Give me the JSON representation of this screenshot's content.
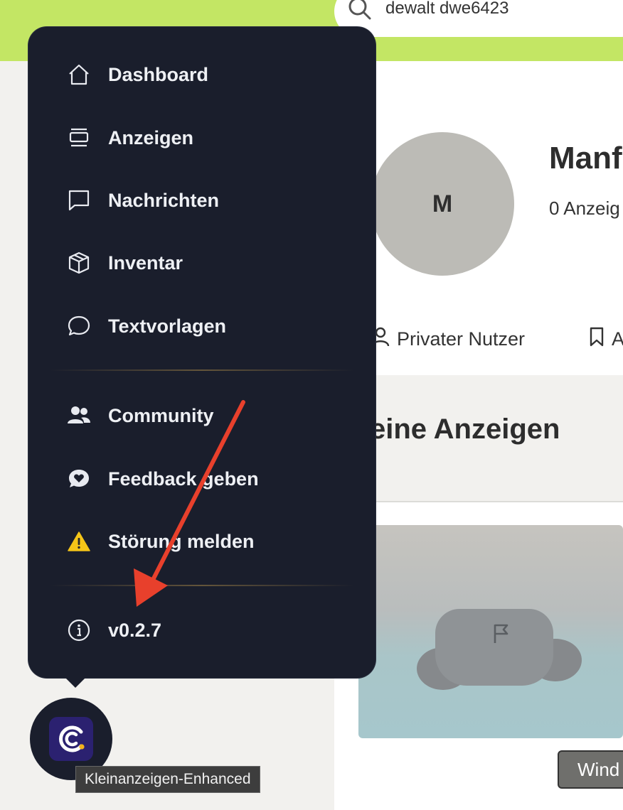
{
  "search": {
    "query": "dewalt dwe6423"
  },
  "profile": {
    "avatar_initial": "M",
    "name": "Manf",
    "listing_count": "0 Anzeig",
    "user_type": "Privater Nutzer",
    "bookmark_label": "A"
  },
  "section": {
    "title": "eine Anzeigen"
  },
  "listing": {
    "button_label": "Wind"
  },
  "menu": {
    "items": [
      {
        "label": "Dashboard",
        "icon": "home-icon"
      },
      {
        "label": "Anzeigen",
        "icon": "listings-icon"
      },
      {
        "label": "Nachrichten",
        "icon": "message-icon"
      },
      {
        "label": "Inventar",
        "icon": "box-icon"
      },
      {
        "label": "Textvorlagen",
        "icon": "chat-bubble-icon"
      },
      {
        "label": "Community",
        "icon": "users-icon"
      },
      {
        "label": "Feedback geben",
        "icon": "heart-bubble-icon"
      },
      {
        "label": "Störung melden",
        "icon": "warning-icon"
      },
      {
        "label": "v0.2.7",
        "icon": "info-icon"
      }
    ]
  },
  "extension": {
    "tooltip": "Kleinanzeigen-Enhanced"
  },
  "colors": {
    "topbar": "#c3e664",
    "menu_bg": "#1a1e2c",
    "annotation_arrow": "#e8402c",
    "warning": "#f5c518",
    "logo_bg": "#2b2170"
  }
}
